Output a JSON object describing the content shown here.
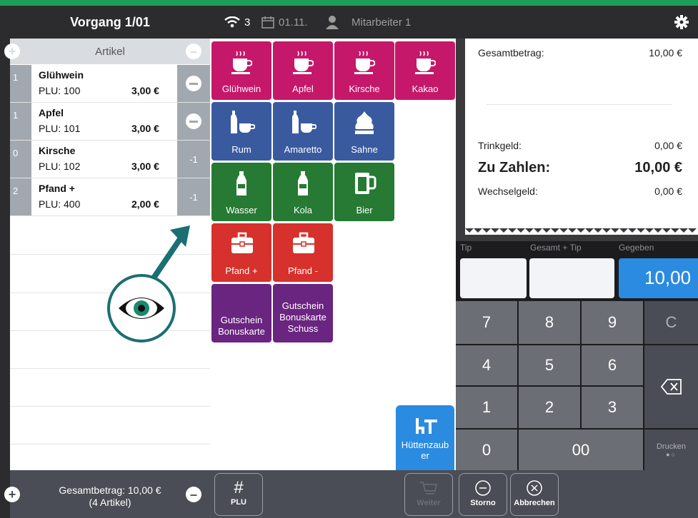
{
  "left": {
    "title": "Vorgang 1/01",
    "artikel_header": "Artikel",
    "rows": [
      {
        "qty": "1",
        "name": "Glühwein",
        "plu": "PLU: 100",
        "price": "3,00 €",
        "action": ""
      },
      {
        "qty": "1",
        "name": "Apfel",
        "plu": "PLU: 101",
        "price": "3,00 €",
        "action": ""
      },
      {
        "qty": "0",
        "name": "Kirsche",
        "plu": "PLU: 102",
        "price": "3,00 €",
        "action": "-1"
      },
      {
        "qty": "2",
        "name": "Pfand +",
        "plu": "PLU: 400",
        "price": "2,00 €",
        "action": "-1"
      }
    ],
    "footer_line1": "Gesamtbetrag: 10,00 €",
    "footer_line2": "(4 Artikel)"
  },
  "status": {
    "wifi_count": "3",
    "date": "01.11.",
    "employee": "Mitarbeiter 1"
  },
  "tiles": {
    "gluehwein": "Glühwein",
    "apfel": "Apfel",
    "kirsche": "Kirsche",
    "kakao": "Kakao",
    "rum": "Rum",
    "amaretto": "Amaretto",
    "sahne": "Sahne",
    "wasser": "Wasser",
    "kola": "Kola",
    "bier": "Bier",
    "pfand_plus": "Pfand +",
    "pfand_minus": "Pfand -",
    "gutschein1_l1": "Gutschein",
    "gutschein1_l2": "Bonuskarte",
    "gutschein2_l1": "Gutschein",
    "gutschein2_l2": "Bonuskarte",
    "gutschein2_l3": "Schuss",
    "huette_l1": "Hüttenzaub",
    "huette_l2": "er"
  },
  "center_footer": {
    "plu": "PLU",
    "weiter": "Weiter"
  },
  "receipt": {
    "gesamt_label": "Gesamtbetrag:",
    "gesamt_value": "10,00 €",
    "trinkgeld_label": "Trinkgeld:",
    "trinkgeld_value": "0,00 €",
    "zuzahlen_label": "Zu Zahlen:",
    "zuzahlen_value": "10,00 €",
    "wechsel_label": "Wechselgeld:",
    "wechsel_value": "0,00 €"
  },
  "pad": {
    "col_tip": "Tip",
    "col_gesamt": "Gesamt + Tip",
    "col_gegeben": "Gegeben",
    "gegeben_value": "10,00",
    "k7": "7",
    "k8": "8",
    "k9": "9",
    "kc": "C",
    "k4": "4",
    "k5": "5",
    "k6": "6",
    "k1": "1",
    "k2": "2",
    "k3": "3",
    "k0": "0",
    "k00": "00",
    "drucken": "Drucken"
  },
  "right_footer": {
    "storno": "Storno",
    "abbrechen": "Abbrechen"
  },
  "colors": {
    "pink": "#c5186a",
    "blue": "#3a5aa0",
    "green": "#267a33",
    "red": "#d6312c",
    "purple": "#6a2580",
    "accent": "#2b8be0"
  }
}
